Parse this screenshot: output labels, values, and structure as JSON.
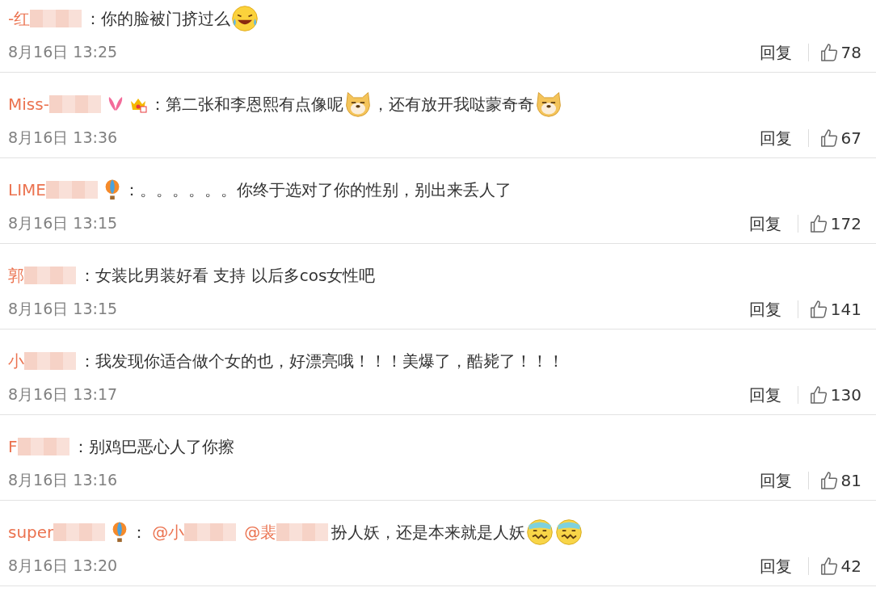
{
  "comments": [
    {
      "name": "-红",
      "content": [
        {
          "kind": "text",
          "text": "：你的脸被门挤过么"
        },
        {
          "kind": "laugh"
        }
      ],
      "time": "8月16日 13:25",
      "reply": "回复",
      "likes": "78"
    },
    {
      "name": "Miss-",
      "badges": [
        {
          "kind": "bunny"
        },
        {
          "kind": "crown"
        }
      ],
      "content": [
        {
          "kind": "text",
          "text": "：第二张和李恩熙有点像呢"
        },
        {
          "kind": "doge"
        },
        {
          "kind": "text",
          "text": "，还有放开我哒蒙奇奇"
        },
        {
          "kind": "doge"
        }
      ],
      "time": "8月16日 13:36",
      "reply": "回复",
      "likes": "67"
    },
    {
      "name": "LIME",
      "badges": [
        {
          "kind": "balloon"
        }
      ],
      "content": [
        {
          "kind": "text",
          "text": "：。。。。。。你终于选对了你的性别，别出来丢人了"
        }
      ],
      "time": "8月16日 13:15",
      "reply": "回复",
      "likes": "172"
    },
    {
      "name": "郭",
      "content": [
        {
          "kind": "text",
          "text": "：女装比男装好看 支持 以后多cos女性吧"
        }
      ],
      "time": "8月16日 13:15",
      "reply": "回复",
      "likes": "141"
    },
    {
      "name": "小",
      "content": [
        {
          "kind": "text",
          "text": "：我发现你适合做个女的也，好漂亮哦！！！美爆了，酷毙了！！！"
        }
      ],
      "time": "8月16日 13:17",
      "reply": "回复",
      "likes": "130"
    },
    {
      "name": "F",
      "content": [
        {
          "kind": "text",
          "text": "：别鸡巴恶心人了你擦"
        }
      ],
      "time": "8月16日 13:16",
      "reply": "回复",
      "likes": "81"
    },
    {
      "name": "super",
      "badges": [
        {
          "kind": "balloon"
        }
      ],
      "content": [
        {
          "kind": "text",
          "text": "："
        },
        {
          "kind": "mention",
          "text": "@小"
        },
        {
          "kind": "mention",
          "text": "@裴"
        },
        {
          "kind": "text",
          "text": "扮人妖，还是本来就是人妖"
        },
        {
          "kind": "awkward"
        },
        {
          "kind": "awkward"
        }
      ],
      "time": "8月16日 13:20",
      "reply": "回复",
      "likes": "42"
    }
  ]
}
